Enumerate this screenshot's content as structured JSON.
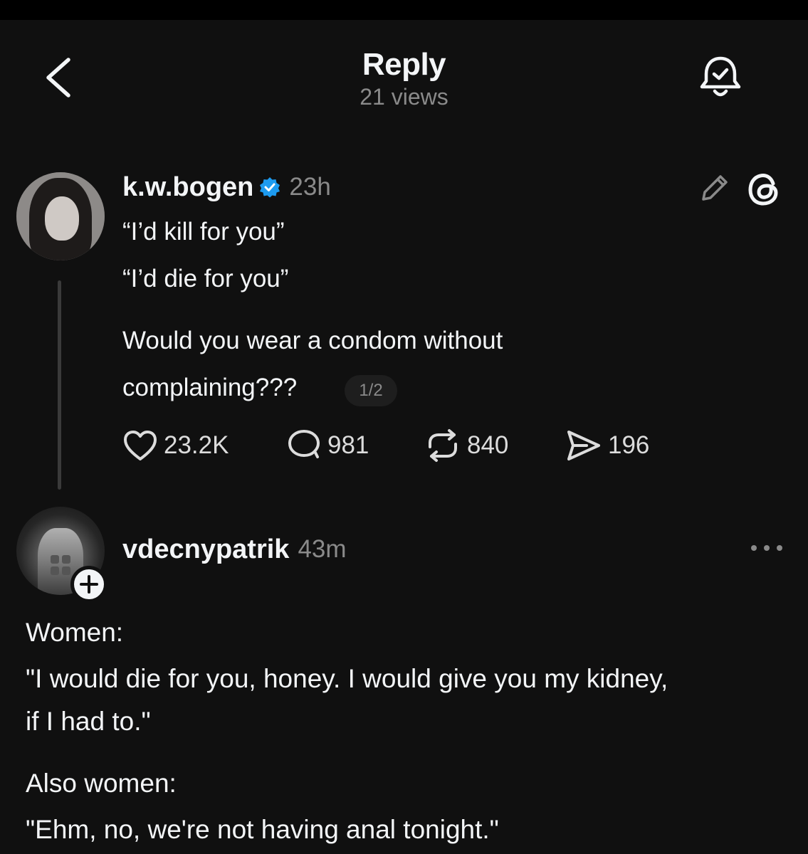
{
  "header": {
    "title": "Reply",
    "views": "21 views"
  },
  "post": {
    "username": "k.w.bogen",
    "time": "23h",
    "lines": [
      "“I’d kill for you”",
      "“I’d die for you”",
      "Would you wear a condom without",
      "complaining???"
    ],
    "page_indicator": "1/2",
    "actions": {
      "likes": "23.2K",
      "replies": "981",
      "reposts": "840",
      "shares": "196"
    }
  },
  "reply": {
    "username": "vdecnypatrik",
    "time": "43m",
    "lines": [
      "Women:",
      "\"I would die for you, honey. I would give you my kidney,",
      "if I had to.\"",
      "Also women:",
      "\"Ehm, no, we're not having anal tonight.\""
    ]
  },
  "icons": {
    "back": "chevron-left-icon",
    "bell": "bell-check-icon",
    "edit": "pencil-icon",
    "threads": "threads-logo-icon",
    "like": "heart-icon",
    "comment": "comment-icon",
    "repost": "repost-icon",
    "share": "send-icon",
    "more": "ellipsis-icon",
    "follow": "plus-icon"
  },
  "colors": {
    "background": "#101010",
    "text": "#f3f5f7",
    "muted": "#8a8a8a",
    "verified": "#1d9bf0"
  }
}
